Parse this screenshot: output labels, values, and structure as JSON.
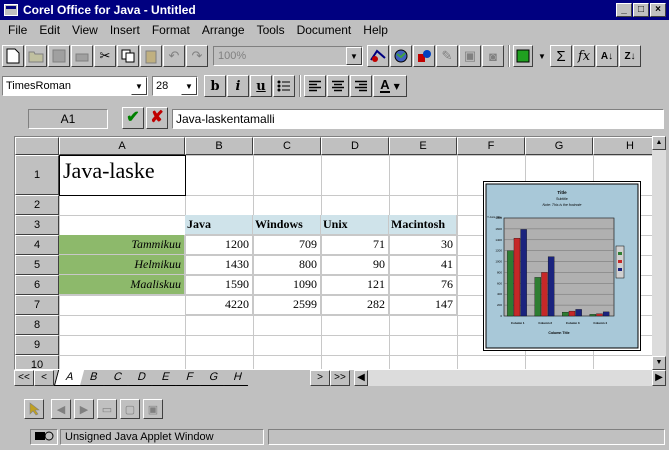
{
  "window": {
    "title": "Corel Office for Java - Untitled",
    "min": "_",
    "max": "□",
    "close": "×"
  },
  "menu": [
    "File",
    "Edit",
    "View",
    "Insert",
    "Format",
    "Arrange",
    "Tools",
    "Document",
    "Help"
  ],
  "toolbar": {
    "zoom": "100%",
    "sum": "Σ",
    "fx": "fx",
    "sort_asc": "A↓",
    "sort_desc": "Z↓"
  },
  "format_bar": {
    "font": "TimesRoman",
    "size": "28",
    "bold": "b",
    "italic": "i",
    "underline": "u",
    "text_color": "A"
  },
  "formula_bar": {
    "cell_ref": "A1",
    "content": "Java-laskentamalli"
  },
  "columns": [
    "A",
    "B",
    "C",
    "D",
    "E",
    "F",
    "G",
    "H"
  ],
  "rows": [
    "1",
    "2",
    "3",
    "4",
    "5",
    "6",
    "7",
    "8",
    "9",
    "10"
  ],
  "cells": {
    "a1": "Java-laske",
    "headers": [
      "Java",
      "Windows",
      "Unix",
      "Macintosh"
    ],
    "months": [
      "Tammikuu",
      "Helmikuu",
      "Maaliskuu"
    ],
    "data": [
      [
        "1200",
        "709",
        "71",
        "30"
      ],
      [
        "1430",
        "800",
        "90",
        "41"
      ],
      [
        "1590",
        "1090",
        "121",
        "76"
      ],
      [
        "4220",
        "2599",
        "282",
        "147"
      ]
    ]
  },
  "sheet_tabs": [
    "A",
    "B",
    "C",
    "D",
    "E",
    "F",
    "G",
    "H"
  ],
  "tab_nav": [
    "<<",
    "<",
    ">",
    ">>"
  ],
  "status": {
    "text": "Unsigned Java Applet Window"
  },
  "colors": {
    "titlebar": "#000080",
    "header_fill": "#cfe3ea",
    "month_fill": "#8db96b",
    "chart_bg": "#a8c8d8"
  },
  "chart_data": {
    "type": "bar",
    "title": "Title",
    "subtitle": "Subtitle",
    "note": "Note: This is the footnote",
    "ylabel": "Y-Axis Title",
    "xlabel": "Column Title",
    "categories": [
      "Column 1",
      "Column 2",
      "Column 3",
      "Column 4"
    ],
    "series": [
      {
        "color": "#2e7d32",
        "values": [
          1200,
          709,
          71,
          30
        ]
      },
      {
        "color": "#c62828",
        "values": [
          1430,
          800,
          90,
          41
        ]
      },
      {
        "color": "#1a237e",
        "values": [
          1590,
          1090,
          121,
          76
        ]
      }
    ],
    "ylim": [
      0,
      1800
    ],
    "legend": "right"
  }
}
